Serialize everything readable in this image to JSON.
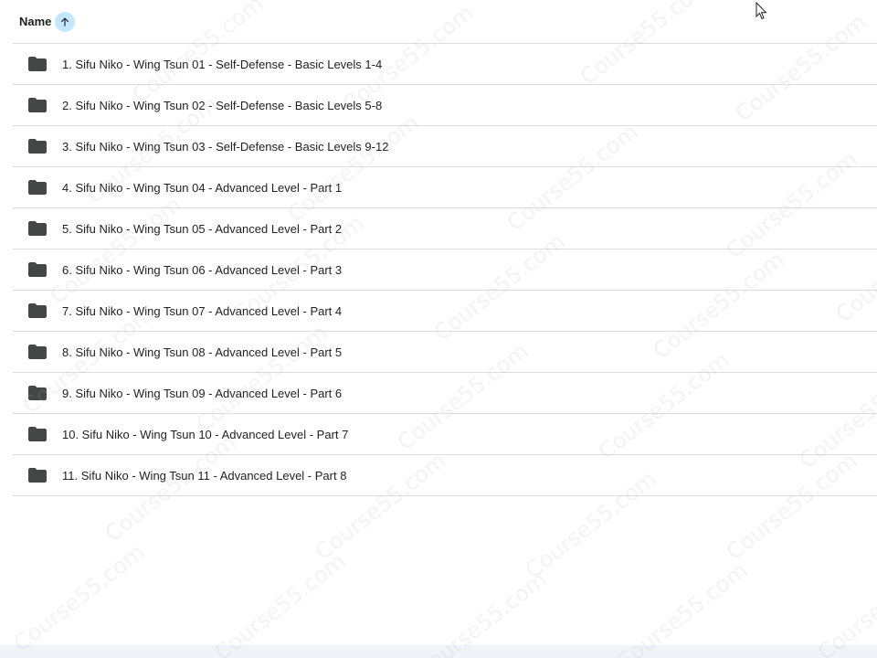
{
  "header": {
    "column_label": "Name",
    "sort_icon": "arrow-up-icon"
  },
  "folders": [
    {
      "label": "1. Sifu Niko - Wing Tsun 01 - Self-Defense - Basic Levels 1-4"
    },
    {
      "label": "2. Sifu Niko - Wing Tsun 02 - Self-Defense - Basic Levels 5-8"
    },
    {
      "label": "3. Sifu Niko - Wing Tsun 03 - Self-Defense - Basic Levels 9-12"
    },
    {
      "label": "4. Sifu Niko - Wing Tsun 04 - Advanced Level - Part 1"
    },
    {
      "label": "5. Sifu Niko - Wing Tsun 05 - Advanced Level - Part 2"
    },
    {
      "label": "6. Sifu Niko - Wing Tsun 06 - Advanced Level - Part 3"
    },
    {
      "label": "7. Sifu Niko - Wing Tsun 07 - Advanced Level - Part 4"
    },
    {
      "label": "8. Sifu Niko - Wing Tsun 08 - Advanced Level - Part 5"
    },
    {
      "label": "9. Sifu Niko - Wing Tsun 09 - Advanced Level - Part 6"
    },
    {
      "label": "10. Sifu Niko - Wing Tsun 10 - Advanced Level - Part 7"
    },
    {
      "label": "11. Sifu Niko - Wing Tsun 11 - Advanced Level - Part 8"
    }
  ],
  "folder_icon": "folder-icon",
  "watermark": "Course55.com",
  "colors": {
    "sort_button_bg": "#c2e7ff",
    "sort_arrow": "#1f1f1f",
    "folder": "#444746",
    "divider": "#dadce0",
    "bottom_bar": "#f0f4f9"
  }
}
